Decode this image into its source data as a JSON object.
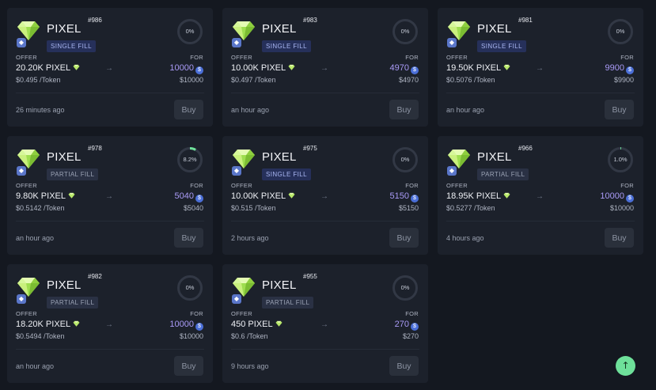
{
  "colors": {
    "background": "#141820",
    "card": "#1c212b",
    "accent_purple": "#a99af6",
    "progress_green": "#6ee09a",
    "scroll_top_button": "#6ee09a"
  },
  "listings": [
    {
      "name": "PIXEL",
      "number": "#986",
      "fill_type": "SINGLE FILL",
      "fill_kind": "single",
      "progress_label": "0%",
      "progress": 0,
      "offer_label": "OFFER",
      "offer_amount": "20.20K PIXEL",
      "price_per_token": "$0.495 /Token",
      "for_label": "FOR",
      "for_amount": "10000",
      "for_usd": "$10000",
      "time": "26 minutes ago",
      "buy_label": "Buy"
    },
    {
      "name": "PIXEL",
      "number": "#983",
      "fill_type": "SINGLE FILL",
      "fill_kind": "single",
      "progress_label": "0%",
      "progress": 0,
      "offer_label": "OFFER",
      "offer_amount": "10.00K PIXEL",
      "price_per_token": "$0.497 /Token",
      "for_label": "FOR",
      "for_amount": "4970",
      "for_usd": "$4970",
      "time": "an hour ago",
      "buy_label": "Buy"
    },
    {
      "name": "PIXEL",
      "number": "#981",
      "fill_type": "SINGLE FILL",
      "fill_kind": "single",
      "progress_label": "0%",
      "progress": 0,
      "offer_label": "OFFER",
      "offer_amount": "19.50K PIXEL",
      "price_per_token": "$0.5076 /Token",
      "for_label": "FOR",
      "for_amount": "9900",
      "for_usd": "$9900",
      "time": "an hour ago",
      "buy_label": "Buy"
    },
    {
      "name": "PIXEL",
      "number": "#978",
      "fill_type": "PARTIAL FILL",
      "fill_kind": "partial",
      "progress_label": "8.2%",
      "progress": 0.082,
      "offer_label": "OFFER",
      "offer_amount": "9.80K PIXEL",
      "price_per_token": "$0.5142 /Token",
      "for_label": "FOR",
      "for_amount": "5040",
      "for_usd": "$5040",
      "time": "an hour ago",
      "buy_label": "Buy"
    },
    {
      "name": "PIXEL",
      "number": "#975",
      "fill_type": "SINGLE FILL",
      "fill_kind": "single",
      "progress_label": "0%",
      "progress": 0,
      "offer_label": "OFFER",
      "offer_amount": "10.00K PIXEL",
      "price_per_token": "$0.515 /Token",
      "for_label": "FOR",
      "for_amount": "5150",
      "for_usd": "$5150",
      "time": "2 hours ago",
      "buy_label": "Buy"
    },
    {
      "name": "PIXEL",
      "number": "#966",
      "fill_type": "PARTIAL FILL",
      "fill_kind": "partial",
      "progress_label": "1.0%",
      "progress": 0.01,
      "offer_label": "OFFER",
      "offer_amount": "18.95K PIXEL",
      "price_per_token": "$0.5277 /Token",
      "for_label": "FOR",
      "for_amount": "10000",
      "for_usd": "$10000",
      "time": "4 hours ago",
      "buy_label": "Buy"
    },
    {
      "name": "PIXEL",
      "number": "#982",
      "fill_type": "PARTIAL FILL",
      "fill_kind": "partial",
      "progress_label": "0%",
      "progress": 0,
      "offer_label": "OFFER",
      "offer_amount": "18.20K PIXEL",
      "price_per_token": "$0.5494 /Token",
      "for_label": "FOR",
      "for_amount": "10000",
      "for_usd": "$10000",
      "time": "an hour ago",
      "buy_label": "Buy"
    },
    {
      "name": "PIXEL",
      "number": "#955",
      "fill_type": "PARTIAL FILL",
      "fill_kind": "partial",
      "progress_label": "0%",
      "progress": 0,
      "offer_label": "OFFER",
      "offer_amount": "450 PIXEL",
      "price_per_token": "$0.6 /Token",
      "for_label": "FOR",
      "for_amount": "270",
      "for_usd": "$270",
      "time": "9 hours ago",
      "buy_label": "Buy"
    }
  ],
  "icons": {
    "token": "gem-icon",
    "chain": "ethereum-icon",
    "currency": "usdc-icon",
    "arrow": "arrow-right-icon",
    "scroll_top": "arrow-up-icon"
  },
  "scroll_top_glyph": "↑"
}
